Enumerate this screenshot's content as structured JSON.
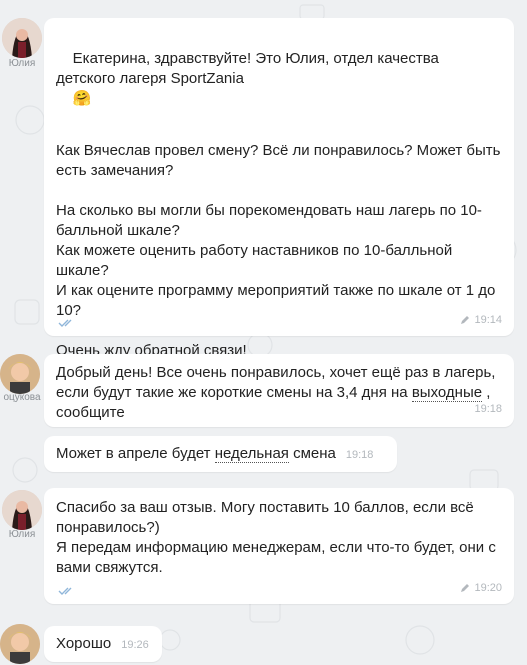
{
  "messages": [
    {
      "sender": "Юлия",
      "text": "Екатерина, здравствуйте! Это Юлия, отдел качества детского лагеря SportZania",
      "emoji": "🤗",
      "text2": "Как Вячеслав провел смену? Всё ли понравилось? Может быть есть замечания?\n\nНа сколько вы могли бы порекомендовать наш лагерь по 10-балльной шкале?\nКак можете оценить работу наставников по 10-балльной шкале?\nИ как оцените программу мероприятий также по шкале от 1 до 10?\n\nОчень жду обратной связи!",
      "time": "19:14"
    },
    {
      "sender": "оцукова",
      "text": "Добрый день! Все очень понравилось, хочет ещё раз в лагерь, если будут такие же короткие смены на 3,4 дня на ",
      "underlined": "выходные",
      "text_after": " , сообщите",
      "time": "19:18"
    },
    {
      "text_before": "Может в апреле будет ",
      "underlined": "недельная",
      "text_after": " смена",
      "time": "19:18"
    },
    {
      "sender": "Юлия",
      "text": "Спасибо за ваш отзыв. Могу поставить 10 баллов, если всё понравилось?)\nЯ передам информацию менеджерам, если что-то будет, они с вами свяжутся.",
      "time": "19:20"
    },
    {
      "text": "Хорошо",
      "time": "19:26"
    }
  ]
}
